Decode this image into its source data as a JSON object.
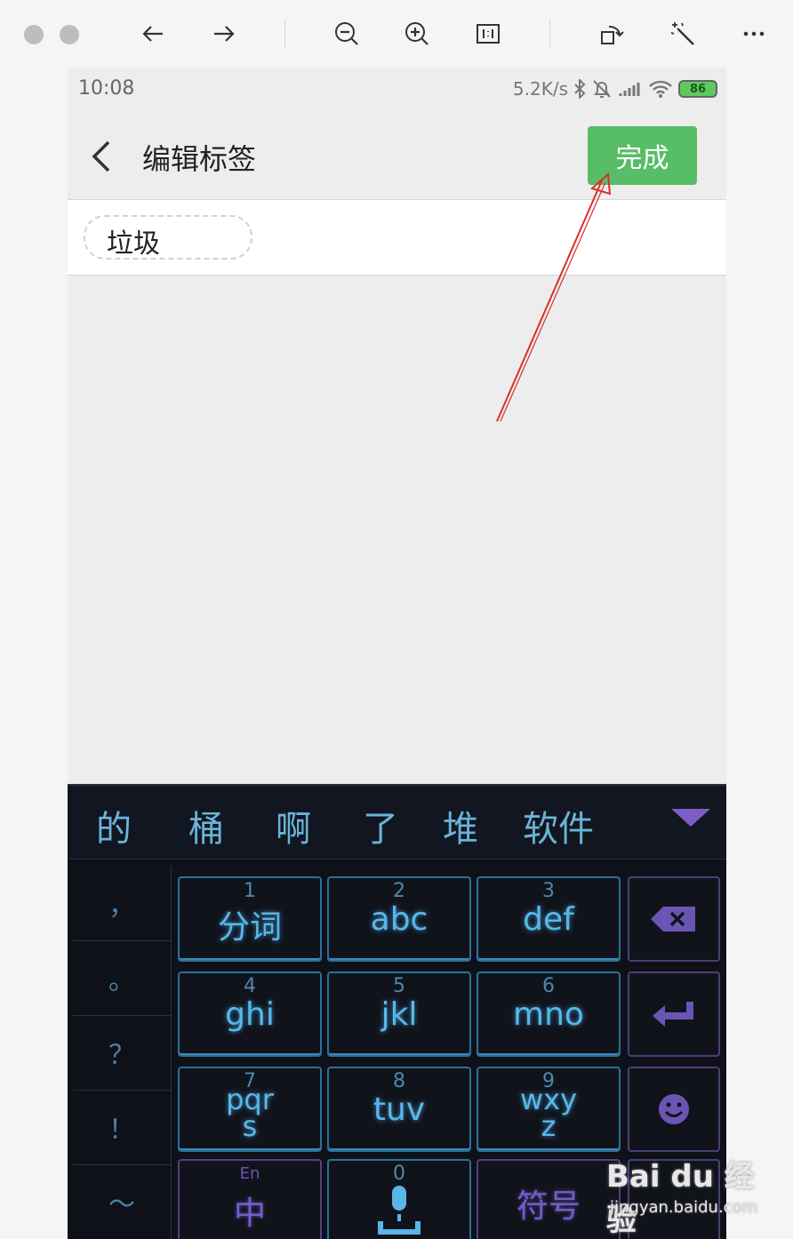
{
  "viewer": {
    "icons": [
      "close-icon",
      "minimize-icon",
      "arrow-left-icon",
      "arrow-right-icon",
      "zoom-out-icon",
      "zoom-in-icon",
      "actual-size-icon",
      "rotate-icon",
      "magic-wand-icon",
      "more-icon"
    ]
  },
  "status_bar": {
    "time": "10:08",
    "speed": "5.2K/s",
    "battery": "86"
  },
  "header": {
    "title": "编辑标签",
    "done_label": "完成"
  },
  "tags": [
    {
      "label": "垃圾"
    }
  ],
  "keyboard": {
    "candidates": [
      "的",
      "桶",
      "啊",
      "了",
      "堆",
      "软件"
    ],
    "punctuation": [
      "，",
      "。",
      "？",
      "！",
      "～"
    ],
    "keys": [
      {
        "num": "1",
        "label": "分词"
      },
      {
        "num": "2",
        "label": "abc"
      },
      {
        "num": "3",
        "label": "def"
      },
      {
        "num": "4",
        "label": "ghi"
      },
      {
        "num": "5",
        "label": "jkl"
      },
      {
        "num": "6",
        "label": "mno"
      },
      {
        "num": "7",
        "label": "pqr s"
      },
      {
        "num": "8",
        "label": "tuv"
      },
      {
        "num": "9",
        "label": "wxy z"
      }
    ],
    "bottom": {
      "lang_small": "En",
      "lang_main": "中",
      "zero": "0",
      "symbols": "符号"
    }
  },
  "watermark": {
    "logo": "Bai du 经验",
    "url": "jingyan.baidu.com"
  },
  "colors": {
    "done_green": "#57bd66",
    "key_blue": "#59b7e8",
    "key_purple": "#7060c8",
    "keyboard_bg": "#0f1118",
    "annotation_red": "#d9302c"
  }
}
